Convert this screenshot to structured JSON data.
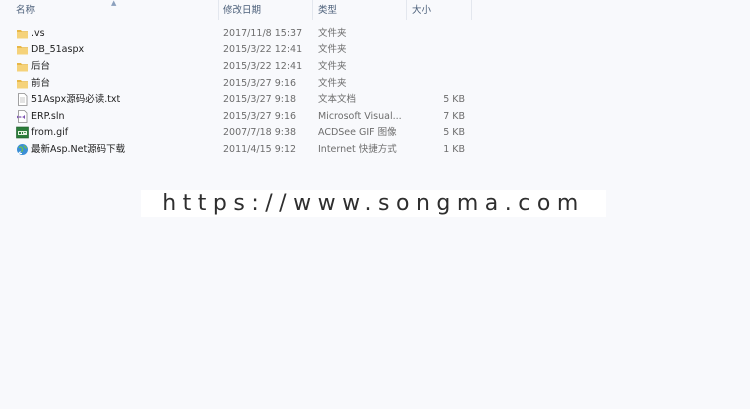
{
  "columns": {
    "name": "名称",
    "modified": "修改日期",
    "type": "类型",
    "size": "大小"
  },
  "files": [
    {
      "icon": "folder-icon",
      "name": ".vs",
      "modified": "2017/11/8 15:37",
      "type": "文件夹",
      "size": ""
    },
    {
      "icon": "folder-icon",
      "name": "DB_51aspx",
      "modified": "2015/3/22 12:41",
      "type": "文件夹",
      "size": ""
    },
    {
      "icon": "folder-icon",
      "name": "后台",
      "modified": "2015/3/22 12:41",
      "type": "文件夹",
      "size": ""
    },
    {
      "icon": "folder-icon",
      "name": "前台",
      "modified": "2015/3/27 9:16",
      "type": "文件夹",
      "size": ""
    },
    {
      "icon": "text-file-icon",
      "name": "51Aspx源码必读.txt",
      "modified": "2015/3/27 9:18",
      "type": "文本文档",
      "size": "5 KB"
    },
    {
      "icon": "solution-file-icon",
      "name": "ERP.sln",
      "modified": "2015/3/27 9:16",
      "type": "Microsoft Visual...",
      "size": "7 KB"
    },
    {
      "icon": "gif-image-icon",
      "name": "from.gif",
      "modified": "2007/7/18 9:38",
      "type": "ACDSee GIF 图像",
      "size": "5 KB"
    },
    {
      "icon": "internet-shortcut-icon",
      "name": "最新Asp.Net源码下载",
      "modified": "2011/4/15 9:12",
      "type": "Internet 快捷方式",
      "size": "1 KB"
    }
  ],
  "watermark": "https://www.songma.com"
}
